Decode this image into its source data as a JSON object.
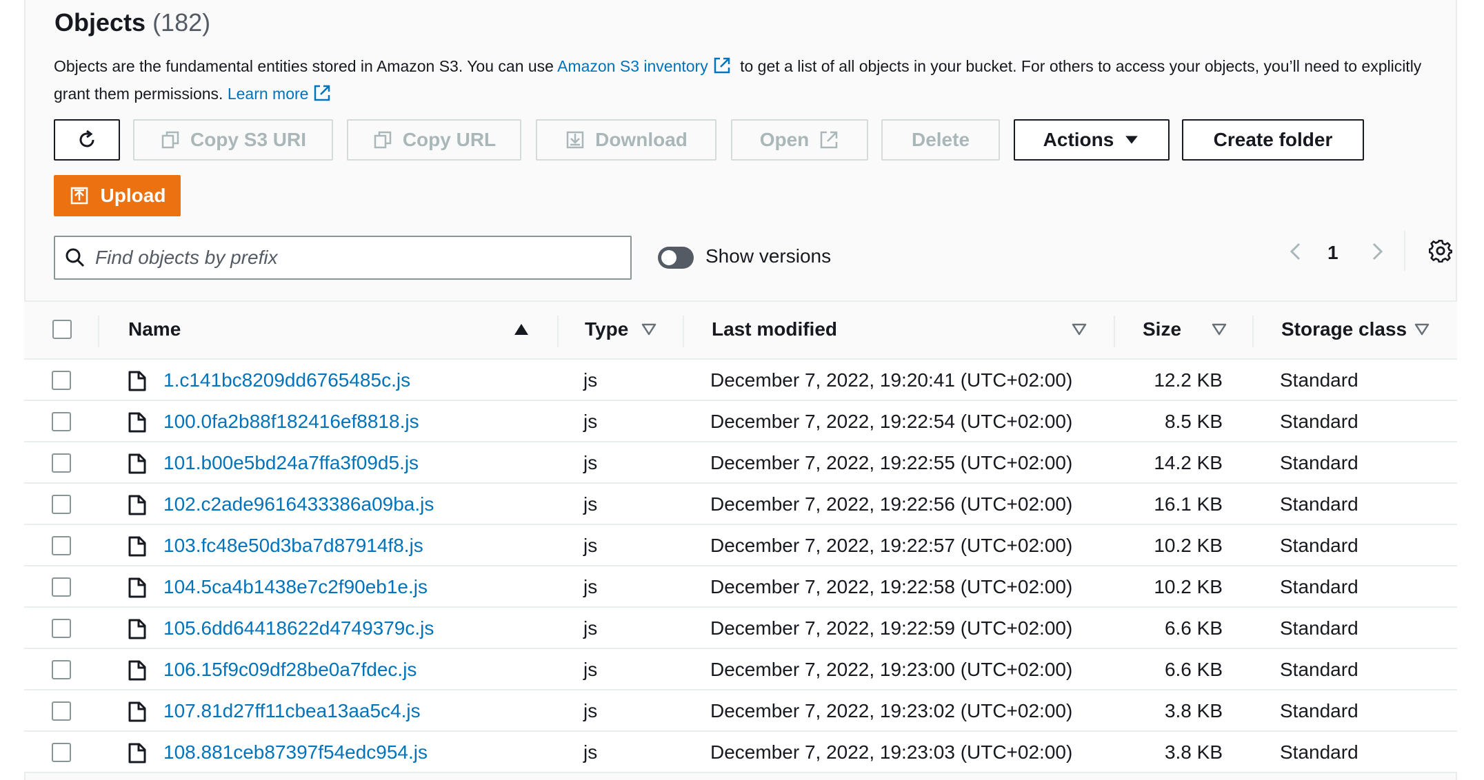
{
  "header": {
    "title": "Objects",
    "count": "(182)",
    "description_part1": "Objects are the fundamental entities stored in Amazon S3. You can use",
    "inventory_link": "Amazon S3 inventory",
    "description_part2": "to get a list of all objects in your bucket. For others to access your objects, you’ll need to explicitly grant them permissions.",
    "learn_more_link": "Learn more"
  },
  "toolbar": {
    "copy_s3_uri": "Copy S3 URI",
    "copy_url": "Copy URL",
    "download": "Download",
    "open": "Open",
    "delete": "Delete",
    "actions": "Actions",
    "create_folder": "Create folder",
    "upload": "Upload"
  },
  "filter": {
    "search_placeholder": "Find objects by prefix",
    "show_versions_label": "Show versions",
    "show_versions_on": false
  },
  "pagination": {
    "current_page": "1"
  },
  "table": {
    "columns": {
      "name": "Name",
      "type": "Type",
      "last_modified": "Last modified",
      "size": "Size",
      "storage_class": "Storage class"
    },
    "rows": [
      {
        "name": "1.c141bc8209dd6765485c.js",
        "type": "js",
        "last_modified": "December 7, 2022, 19:20:41 (UTC+02:00)",
        "size": "12.2 KB",
        "storage_class": "Standard"
      },
      {
        "name": "100.0fa2b88f182416ef8818.js",
        "type": "js",
        "last_modified": "December 7, 2022, 19:22:54 (UTC+02:00)",
        "size": "8.5 KB",
        "storage_class": "Standard"
      },
      {
        "name": "101.b00e5bd24a7ffa3f09d5.js",
        "type": "js",
        "last_modified": "December 7, 2022, 19:22:55 (UTC+02:00)",
        "size": "14.2 KB",
        "storage_class": "Standard"
      },
      {
        "name": "102.c2ade9616433386a09ba.js",
        "type": "js",
        "last_modified": "December 7, 2022, 19:22:56 (UTC+02:00)",
        "size": "16.1 KB",
        "storage_class": "Standard"
      },
      {
        "name": "103.fc48e50d3ba7d87914f8.js",
        "type": "js",
        "last_modified": "December 7, 2022, 19:22:57 (UTC+02:00)",
        "size": "10.2 KB",
        "storage_class": "Standard"
      },
      {
        "name": "104.5ca4b1438e7c2f90eb1e.js",
        "type": "js",
        "last_modified": "December 7, 2022, 19:22:58 (UTC+02:00)",
        "size": "10.2 KB",
        "storage_class": "Standard"
      },
      {
        "name": "105.6dd64418622d4749379c.js",
        "type": "js",
        "last_modified": "December 7, 2022, 19:22:59 (UTC+02:00)",
        "size": "6.6 KB",
        "storage_class": "Standard"
      },
      {
        "name": "106.15f9c09df28be0a7fdec.js",
        "type": "js",
        "last_modified": "December 7, 2022, 19:23:00 (UTC+02:00)",
        "size": "6.6 KB",
        "storage_class": "Standard"
      },
      {
        "name": "107.81d27ff11cbea13aa5c4.js",
        "type": "js",
        "last_modified": "December 7, 2022, 19:23:02 (UTC+02:00)",
        "size": "3.8 KB",
        "storage_class": "Standard"
      },
      {
        "name": "108.881ceb87397f54edc954.js",
        "type": "js",
        "last_modified": "December 7, 2022, 19:23:03 (UTC+02:00)",
        "size": "3.8 KB",
        "storage_class": "Standard"
      }
    ]
  },
  "colors": {
    "link": "#0073bb",
    "upload_button": "#ec7211",
    "disabled_text": "#aab7b8",
    "text": "#16191f"
  }
}
